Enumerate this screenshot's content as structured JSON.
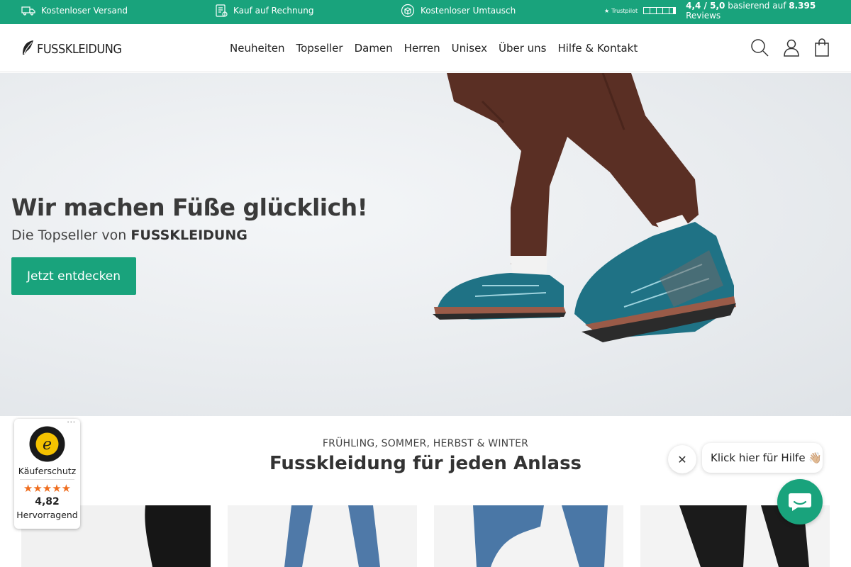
{
  "topbar": {
    "shipping": "Kostenloser Versand",
    "invoice": "Kauf auf Rechnung",
    "exchange": "Kostenloser Umtausch",
    "trustpilot_logo": "Trustpilot",
    "rating": "4,4 / 5,0",
    "based_on": "basierend auf",
    "reviews_count": "8.395",
    "reviews_label": "Reviews"
  },
  "header": {
    "logo_text": "FUSSKLEIDUNG",
    "nav": [
      "Neuheiten",
      "Topseller",
      "Damen",
      "Herren",
      "Unisex",
      "Über uns",
      "Hilfe & Kontakt"
    ],
    "icons": [
      "search-icon",
      "account-icon",
      "cart-icon"
    ]
  },
  "hero": {
    "title": "Wir machen Füße glücklich!",
    "subtitle_prefix": "Die Topseller von",
    "subtitle_brand": "FUSSKLEIDUNG",
    "cta": "Jetzt entdecken"
  },
  "section": {
    "eyebrow": "FRÜHLING, SOMMER, HERBST & WINTER",
    "title": "Fusskleidung für jeden Anlass"
  },
  "trusted_shops": {
    "label": "Käuferschutz",
    "stars": "★★★★★",
    "score": "4,82",
    "grade": "Hervorragend",
    "menu": "···",
    "seal_letter": "e"
  },
  "chat": {
    "close": "✕",
    "bubble": "Klick hier für Hilfe 👋🏼"
  },
  "colors": {
    "accent": "#19a37c",
    "star": "#ef6d1e"
  }
}
